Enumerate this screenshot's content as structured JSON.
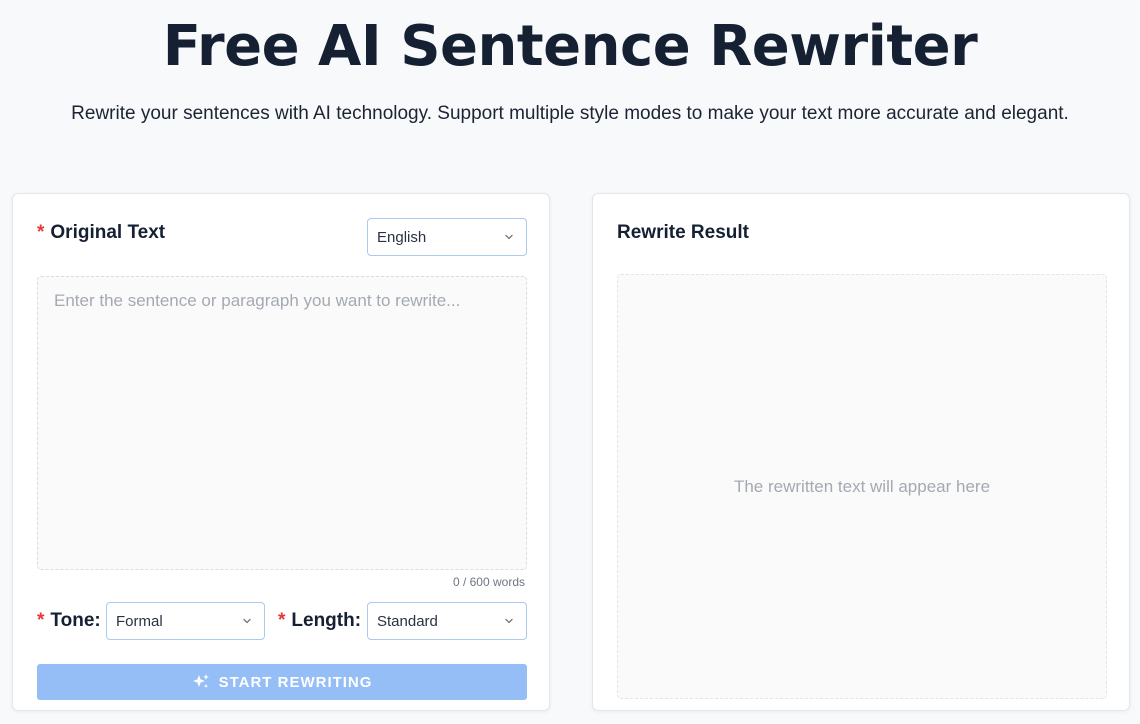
{
  "header": {
    "title": "Free AI Sentence Rewriter",
    "subtitle": "Rewrite your sentences with AI technology. Support multiple style modes to make your text more accurate and elegant."
  },
  "input_panel": {
    "required_mark": "*",
    "title": "Original Text",
    "language": {
      "selected": "English"
    },
    "textarea": {
      "value": "",
      "placeholder": "Enter the sentence or paragraph you want to rewrite..."
    },
    "word_count": "0 / 600 words",
    "tone": {
      "label": "Tone:",
      "selected": "Formal"
    },
    "length": {
      "label": "Length:",
      "selected": "Standard"
    },
    "submit_label": "START REWRITING"
  },
  "result_panel": {
    "title": "Rewrite Result",
    "placeholder": "The rewritten text will appear here"
  },
  "colors": {
    "accent_button": "#94bef5",
    "required": "#e53935",
    "select_border": "#a9cbee"
  }
}
